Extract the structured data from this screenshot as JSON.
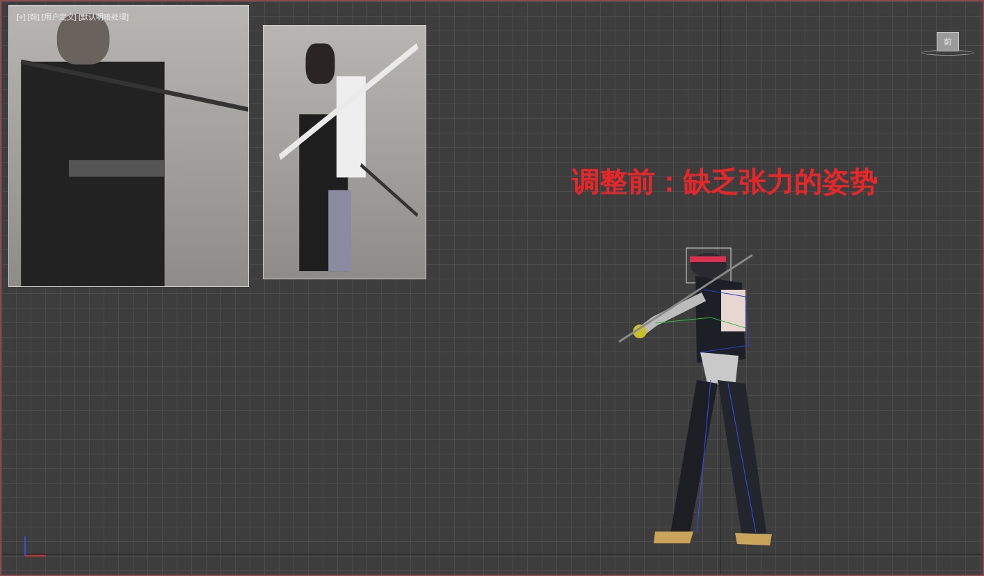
{
  "viewport": {
    "label": "[+] [前] [用户定义] [默认明暗处理]",
    "annotation": "调整前：缺乏张力的姿势",
    "viewcube": "前"
  }
}
